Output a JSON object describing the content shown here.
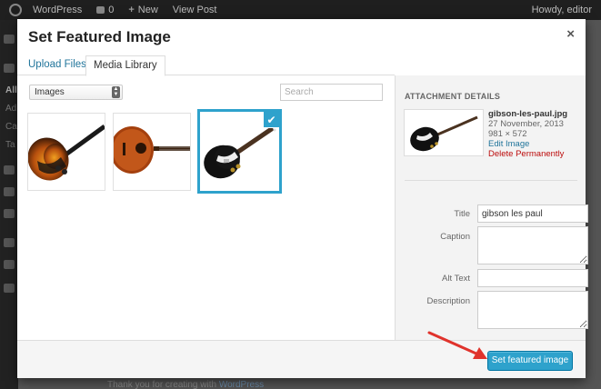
{
  "adminbar": {
    "site_name": "WordPress",
    "comments_count": "0",
    "new_label": "New",
    "view_post": "View Post",
    "greeting": "Howdy, editor"
  },
  "admin_menu": {
    "labels": [
      "All",
      "Ad",
      "Ca",
      "Ta"
    ]
  },
  "modal": {
    "title": "Set Featured Image",
    "close_glyph": "×",
    "tabs": [
      {
        "label": "Upload Files",
        "active": false
      },
      {
        "label": "Media Library",
        "active": true
      }
    ],
    "filter": {
      "selected": "Images"
    },
    "search": {
      "placeholder": "Search"
    },
    "attachments": [
      {
        "name": "sunburst electric guitar",
        "selected": false
      },
      {
        "name": "acoustic guitar",
        "selected": false
      },
      {
        "name": "gibson les paul",
        "selected": true
      }
    ],
    "details": {
      "heading": "ATTACHMENT DETAILS",
      "filename": "gibson-les-paul.jpg",
      "date": "27 November, 2013",
      "dimensions": "981 × 572",
      "edit_link": "Edit Image",
      "delete_link": "Delete Permanently",
      "fields": {
        "title_label": "Title",
        "title_value": "gibson les paul",
        "caption_label": "Caption",
        "caption_value": "",
        "alt_label": "Alt Text",
        "alt_value": "",
        "description_label": "Description",
        "description_value": ""
      }
    },
    "footer": {
      "primary_button": "Set featured image"
    }
  },
  "page_footer": {
    "text": "Thank you for creating with ",
    "link": "WordPress"
  },
  "colors": {
    "accent": "#2ea2cc",
    "link": "#21759b",
    "delete": "#bc0b0b",
    "annotation_arrow": "#e0332c"
  }
}
